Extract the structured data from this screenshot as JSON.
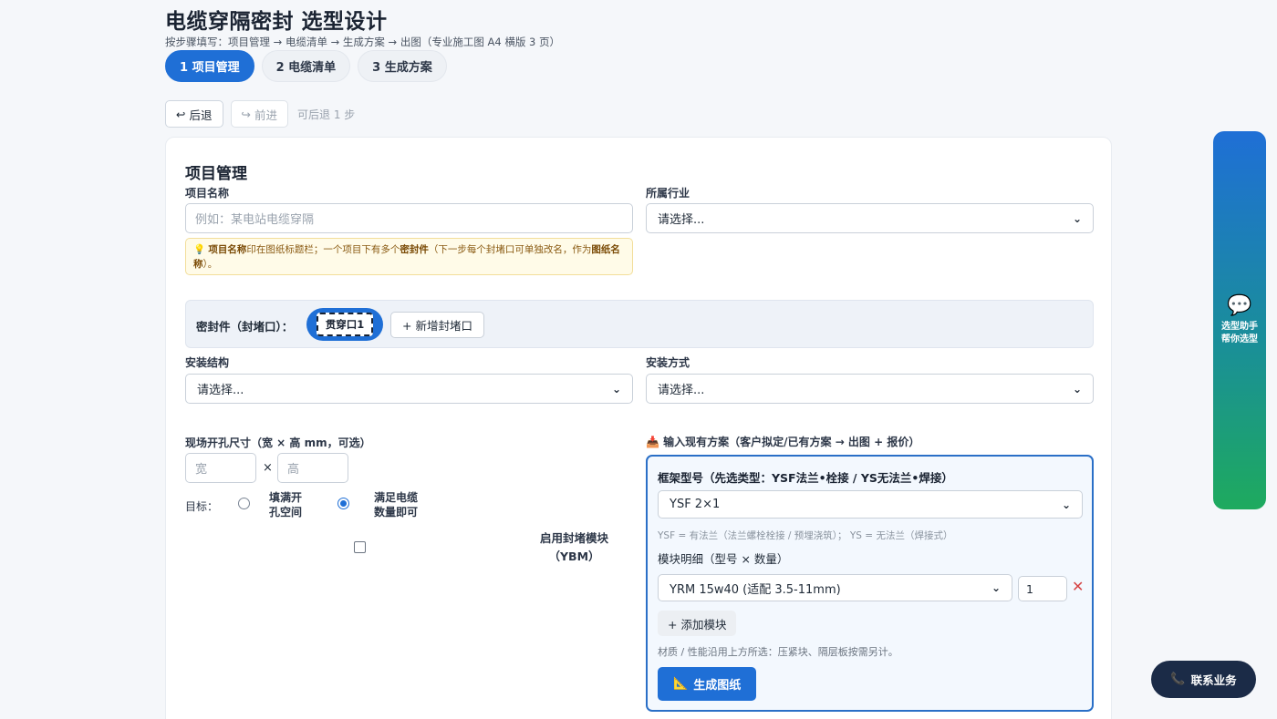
{
  "header": {
    "title": "电缆穿隔密封 选型设计",
    "subtitle": "按步骤填写：项目管理 → 电缆清单 → 生成方案 → 出图（专业施工图 A4 横版 3 页）"
  },
  "steps": [
    {
      "label": "1 项目管理"
    },
    {
      "label": "2 电缆清单"
    },
    {
      "label": "3 生成方案"
    }
  ],
  "history": {
    "back_icon": "↩",
    "back_label": "后退",
    "forward_icon": "↪",
    "forward_label": "前进",
    "status": "可后退 1 步"
  },
  "project": {
    "section_title": "项目管理",
    "name_label": "项目名称",
    "name_placeholder": "例如：某电站电缆穿隔",
    "industry_label": "所属行业",
    "industry_value": "请选择...",
    "tip_icon": "💡",
    "tip_bold1": "项目名称",
    "tip_text1": "印在图纸标题栏；一个项目下有多个",
    "tip_bold2": "密封件",
    "tip_text2": "（下一步每个封堵口可单独改名，作为",
    "tip_bold3": "图纸名称",
    "tip_text3": "）。"
  },
  "seals": {
    "label": "密封件（封堵口）：",
    "current": "贯穿口1",
    "add_label": "+ 新增封堵口"
  },
  "install": {
    "structure_label": "安装结构",
    "structure_value": "请选择...",
    "method_label": "安装方式",
    "method_value": "请选择..."
  },
  "opening": {
    "label": "现场开孔尺寸（宽 × 高 mm，可选）",
    "width_placeholder": "宽",
    "times": "×",
    "height_placeholder": "高",
    "goal_label": "目标：",
    "option1": "填满开孔空间",
    "option2": "满足电缆数量即可",
    "ybm_label": "启用封堵模块（YBM）"
  },
  "existing": {
    "icon": "📥",
    "label": "输入现有方案（客户拟定/已有方案 → 出图 + 报价）",
    "frame_label": "框架型号（先选类型：YSF法兰•栓接 / YS无法兰•焊接）",
    "frame_value": "YSF 2×1",
    "frame_note": "YSF = 有法兰（法兰螺栓栓接 / 预埋浇筑）； YS = 无法兰（焊接式）",
    "module_label": "模块明细（型号 × 数量）",
    "module_value": "YRM 15w40 (适配 3.5-11mm)",
    "module_qty": "1",
    "remove_icon": "✕",
    "add_module": "+ 添加模块",
    "footnote": "材质 / 性能沿用上方所选：压紧块、隔层板按需另计。",
    "generate_icon": "📐",
    "generate_label": "生成图纸"
  },
  "assistant": {
    "icon": "💬",
    "line1": "选型助手",
    "line2": "帮你选型"
  },
  "contact": {
    "icon": "📞",
    "label": "联系业务"
  }
}
